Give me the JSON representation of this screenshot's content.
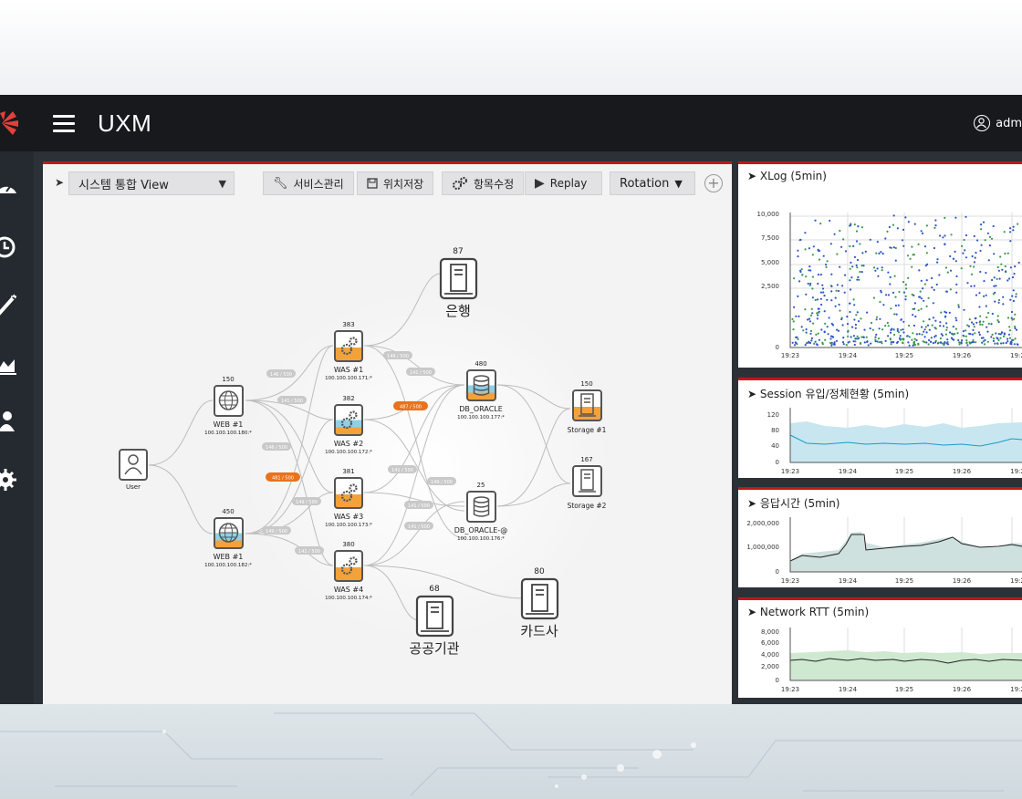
{
  "app": {
    "title": "UXM",
    "user": "adm"
  },
  "toolbar": {
    "view_select": "시스템 통합 View",
    "service_btn": "서비스관리",
    "save_pos_btn": "위치저장",
    "edit_items_btn": "항목수정",
    "replay_btn": "Replay",
    "rotation_select": "Rotation"
  },
  "topology": {
    "nodes": {
      "user": {
        "label": "User"
      },
      "web1a": {
        "label": "WEB #1",
        "count": "150",
        "ip": "100.100.100.180:*"
      },
      "web1b": {
        "label": "WEB #1",
        "count": "450",
        "ip": "100.100.100.182:*"
      },
      "was1": {
        "label": "WAS #1",
        "count": "383",
        "ip": "100.100.100.171:*"
      },
      "was2": {
        "label": "WAS #2",
        "count": "382",
        "ip": "100.100.100.172:*"
      },
      "was3": {
        "label": "WAS #3",
        "count": "381",
        "ip": "100.100.100.173:*"
      },
      "was4": {
        "label": "WAS #4",
        "count": "380",
        "ip": "100.100.100.174:*"
      },
      "db1": {
        "label": "DB_ORACLE",
        "count": "480",
        "ip": "100.100.100.177:*"
      },
      "db2": {
        "label": "DB_ORACLE-@",
        "count": "25",
        "ip": "100.100.100.176:*"
      },
      "storage1": {
        "label": "Storage #1",
        "count": "150"
      },
      "storage2": {
        "label": "Storage #2",
        "count": "167"
      },
      "bank": {
        "label": "은행",
        "count": "87"
      },
      "card": {
        "label": "카드사",
        "count": "80"
      },
      "public": {
        "label": "공공기관",
        "count": "68"
      }
    },
    "badges": {
      "b1": "146 / 500",
      "b2": "141 / 500",
      "b3": "146 / 500",
      "b4": "481 / 500",
      "b5": "149 / 500",
      "b6": "149 / 500",
      "b7": "142 / 500",
      "b8": "149 / 500",
      "b9": "141 / 500",
      "b10": "487 / 500",
      "b11": "141 / 500",
      "b12": "149 / 500",
      "b13": "141 / 500",
      "b14": "141 / 500"
    }
  },
  "panels": {
    "xlog": {
      "title": "XLog (5min)",
      "y_ticks": [
        "10,000",
        "7,500",
        "5,000",
        "2,500",
        "0"
      ],
      "x_ticks": [
        "19:23",
        "19:24",
        "19:25",
        "19:26",
        "19:2"
      ],
      "colors": {
        "blue": "#2f55c8",
        "green": "#3a9a4a"
      }
    },
    "session": {
      "title": "Session 유입/정체현황 (5min)",
      "y_ticks": [
        "120",
        "80",
        "40",
        "0"
      ],
      "x_ticks": [
        "19:23",
        "19:24",
        "19:25",
        "19:26",
        "19:2"
      ]
    },
    "response": {
      "title": "응답시간 (5min)",
      "y_ticks": [
        "2,000,000",
        "1,000,000",
        "0"
      ],
      "x_ticks": [
        "19:23",
        "19:24",
        "19:25",
        "19:26",
        "19:2"
      ]
    },
    "rtt": {
      "title": "Network RTT (5min)",
      "y_ticks": [
        "8,000",
        "6,000",
        "4,000",
        "2,000",
        "0"
      ],
      "x_ticks": [
        "19:23",
        "19:24",
        "19:25",
        "19:26",
        "19:2"
      ]
    }
  }
}
